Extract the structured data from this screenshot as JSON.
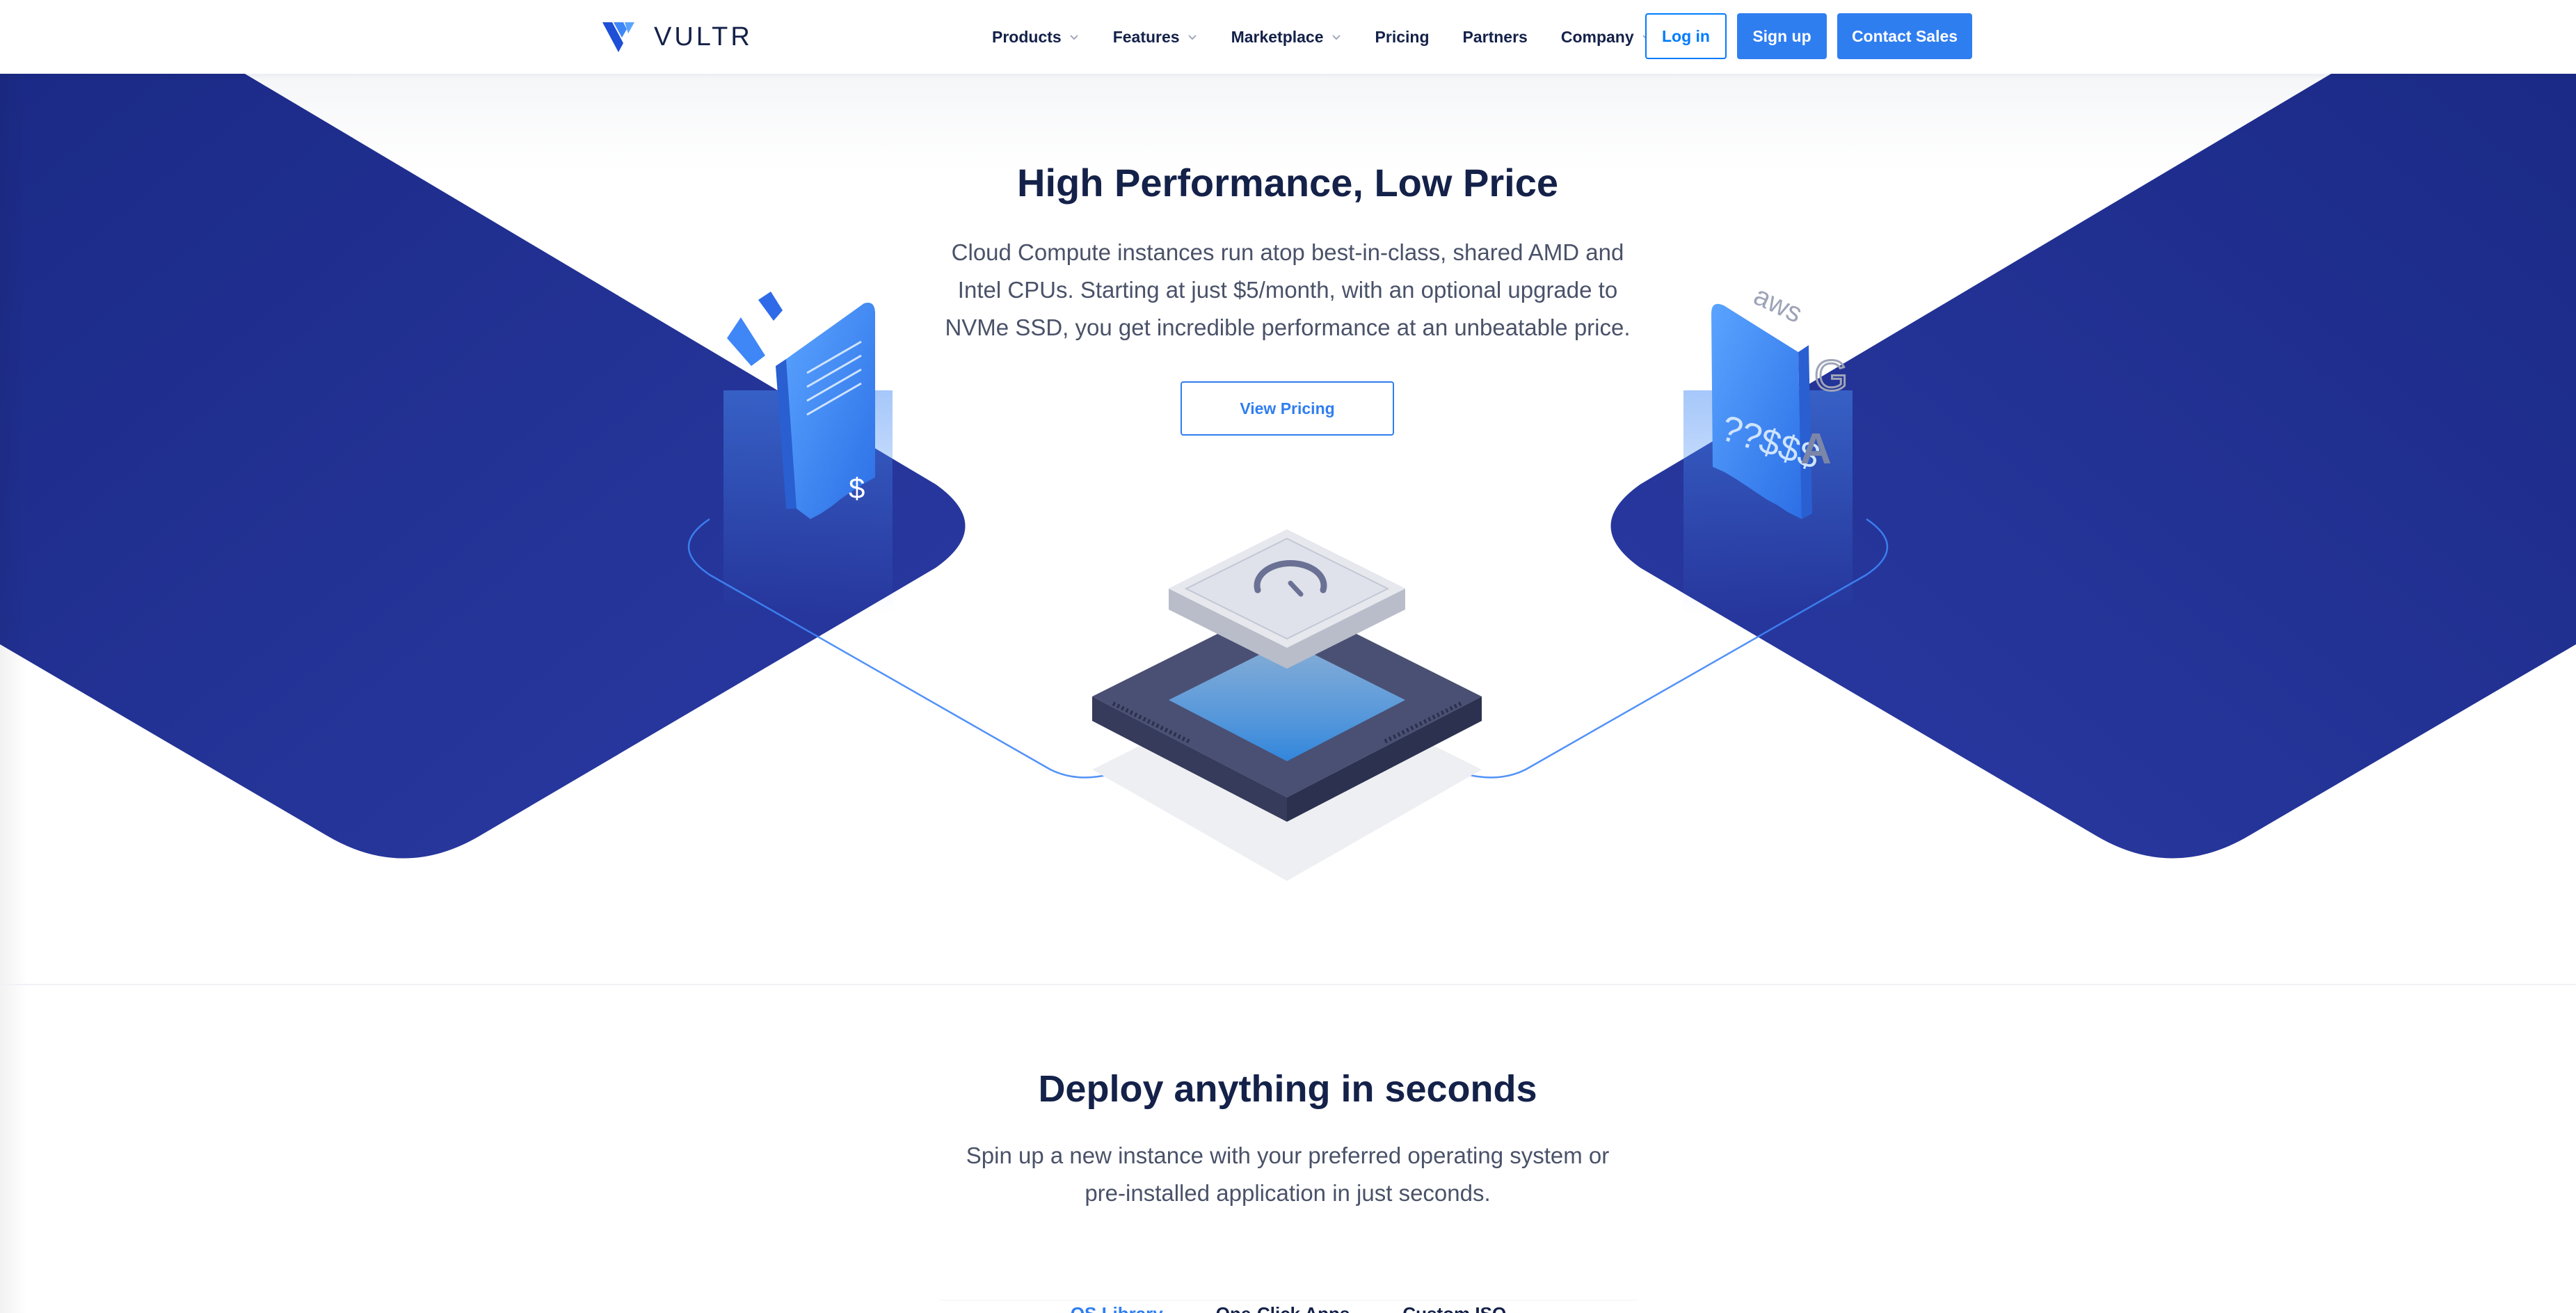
{
  "nav": {
    "brand": "VULTR",
    "menu": [
      {
        "label": "Products",
        "has_dropdown": true
      },
      {
        "label": "Features",
        "has_dropdown": true
      },
      {
        "label": "Marketplace",
        "has_dropdown": true
      },
      {
        "label": "Pricing",
        "has_dropdown": false
      },
      {
        "label": "Partners",
        "has_dropdown": false
      },
      {
        "label": "Company",
        "has_dropdown": true
      }
    ],
    "login_label": "Log in",
    "signup_label": "Sign up",
    "contact_label": "Contact Sales"
  },
  "hero": {
    "title": "High Performance, Low Price",
    "description": "Cloud Compute instances run atop best-in-class, shared AMD and Intel CPUs. Starting at just $5/month, with an optional upgrade to NVMe SSD, you get incredible performance at an unbeatable price.",
    "cta_label": "View Pricing",
    "illustrations": {
      "left": "vultr-receipt-icon",
      "center": "cpu-chip-icon",
      "right": "competitor-receipts-icon",
      "left_receipt_symbol": "$",
      "right_receipt_symbols": "??$$$",
      "right_brand_marks": [
        "aws",
        "G",
        "A"
      ]
    }
  },
  "deploy": {
    "title": "Deploy anything in seconds",
    "description": "Spin up a new instance with your preferred operating system or pre-installed application in just seconds.",
    "tabs": [
      {
        "label": "OS Library",
        "active": true
      },
      {
        "label": "One-Click Apps",
        "active": false
      },
      {
        "label": "Custom ISO",
        "active": false
      }
    ]
  },
  "colors": {
    "navy": "#142149",
    "hero_band": "#233394",
    "accent_blue": "#2f7ef0",
    "login_border": "#007bfc"
  }
}
